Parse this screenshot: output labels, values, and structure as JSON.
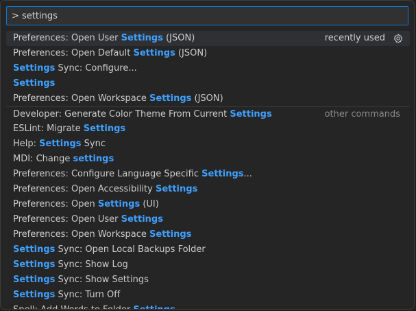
{
  "search": {
    "value": "> settings"
  },
  "colors": {
    "highlight": "#3fa1ff",
    "accent_border": "#0e79d4"
  },
  "items": [
    {
      "before": "Preferences: Open User ",
      "match": "Settings",
      "after": " (JSON)",
      "badge": "recently used",
      "icon": "gear-icon"
    },
    {
      "before": "Preferences: Open Default ",
      "match": "Settings",
      "after": " (JSON)"
    },
    {
      "before": "",
      "match": "Settings",
      "after": " Sync: Configure..."
    },
    {
      "before": "",
      "match": "Settings",
      "after": ""
    },
    {
      "before": "Preferences: Open Workspace ",
      "match": "Settings",
      "after": " (JSON)"
    },
    {
      "before": "Developer: Generate Color Theme From Current ",
      "match": "Settings",
      "after": "",
      "badge": "other commands"
    },
    {
      "before": "ESLint: Migrate ",
      "match": "Settings",
      "after": ""
    },
    {
      "before": "Help: ",
      "match": "Settings",
      "after": " Sync"
    },
    {
      "before": "MDI: Change ",
      "match": "settings",
      "after": ""
    },
    {
      "before": "Preferences: Configure Language Specific ",
      "match": "Settings",
      "after": "..."
    },
    {
      "before": "Preferences: Open Accessibility ",
      "match": "Settings",
      "after": ""
    },
    {
      "before": "Preferences: Open ",
      "match": "Settings",
      "after": " (UI)"
    },
    {
      "before": "Preferences: Open User ",
      "match": "Settings",
      "after": ""
    },
    {
      "before": "Preferences: Open Workspace ",
      "match": "Settings",
      "after": ""
    },
    {
      "before": "",
      "match": "Settings",
      "after": " Sync: Open Local Backups Folder"
    },
    {
      "before": "",
      "match": "Settings",
      "after": " Sync: Show Log"
    },
    {
      "before": "",
      "match": "Settings",
      "after": " Sync: Show Settings"
    },
    {
      "before": "",
      "match": "Settings",
      "after": " Sync: Turn Off"
    },
    {
      "before": "Spell: Add Words to Folder ",
      "match": "Settings",
      "after": ""
    }
  ]
}
